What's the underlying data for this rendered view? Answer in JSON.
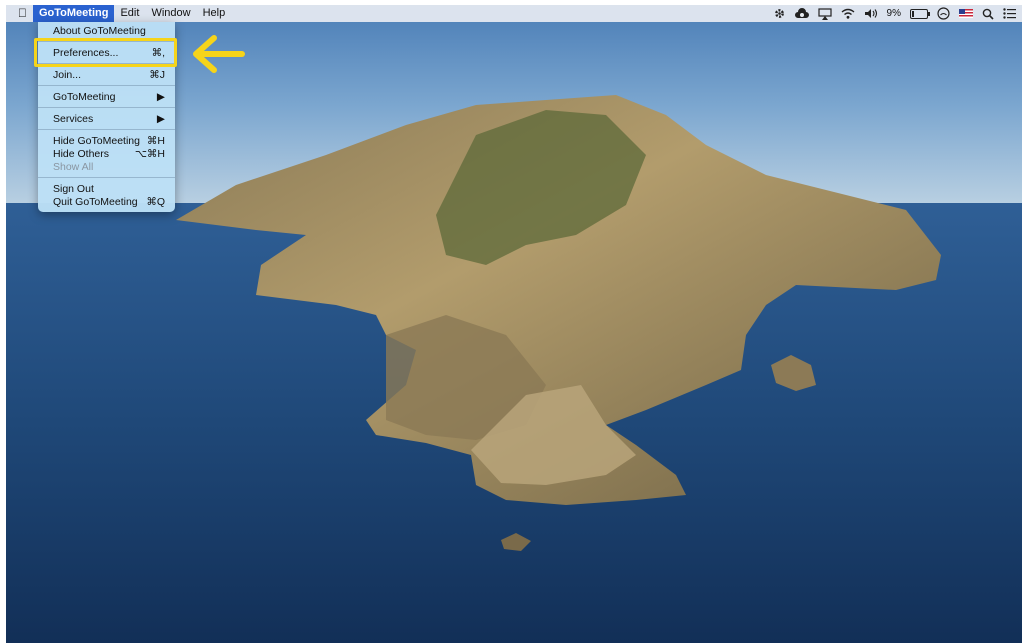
{
  "menubar": {
    "apple_icon": "apple-logo-icon",
    "items": [
      {
        "label": "GoToMeeting",
        "active": true
      },
      {
        "label": "Edit",
        "active": false
      },
      {
        "label": "Window",
        "active": false
      },
      {
        "label": "Help",
        "active": false
      }
    ],
    "status": {
      "battery_percent": "9%",
      "icons": [
        "gear-icon",
        "creative-cloud-icon",
        "airplay-icon",
        "wifi-icon",
        "volume-icon",
        "battery-icon",
        "user-circle-icon",
        "us-flag-icon",
        "spotlight-search-icon",
        "notification-center-icon"
      ]
    }
  },
  "menu": {
    "items": [
      {
        "label": "About GoToMeeting",
        "shortcut": ""
      },
      {
        "label": "Preferences...",
        "shortcut": "⌘,"
      },
      {
        "label": "Join...",
        "shortcut": "⌘J"
      },
      {
        "label": "GoToMeeting",
        "shortcut": "▶"
      },
      {
        "label": "Services",
        "shortcut": "▶"
      },
      {
        "label": "Hide GoToMeeting",
        "shortcut": "⌘H"
      },
      {
        "label": "Hide Others",
        "shortcut": "⌥⌘H"
      },
      {
        "label": "Show All",
        "shortcut": "",
        "disabled": true
      },
      {
        "label": "Sign Out",
        "shortcut": ""
      },
      {
        "label": "Quit GoToMeeting",
        "shortcut": "⌘Q"
      }
    ]
  },
  "annotation": {
    "highlight_color": "#f6d41a",
    "arrow_color": "#f6d41a"
  },
  "colors": {
    "menu_active": "#2a62d0",
    "menu_bg": "#bce0f6"
  }
}
